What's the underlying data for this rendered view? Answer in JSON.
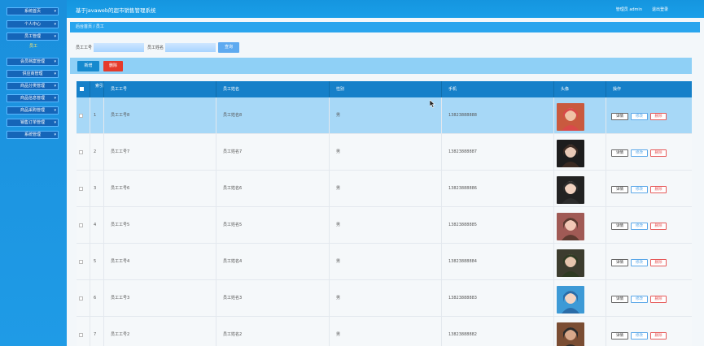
{
  "app": {
    "title": "基于javaweb的超市销售管理系统",
    "user_label": "管理员 admin",
    "logout_label": "退出登录"
  },
  "sidebar": {
    "items": [
      {
        "label": "系统首页"
      },
      {
        "label": "个人中心"
      },
      {
        "label": "员工管理"
      },
      {
        "label": "员工"
      },
      {
        "label": "会员档案管理"
      },
      {
        "label": "供应商管理"
      },
      {
        "label": "商品分类管理"
      },
      {
        "label": "商品信息管理"
      },
      {
        "label": "商品采购管理"
      },
      {
        "label": "销售订单管理"
      },
      {
        "label": "系统管理"
      }
    ]
  },
  "breadcrumb": {
    "home": "后台首页",
    "sep": "/",
    "current": "员工"
  },
  "search": {
    "field1_label": "员工工号",
    "field1_value": "",
    "field2_label": "员工姓名",
    "field2_value": "",
    "button_label": "查询"
  },
  "toolbar": {
    "add_label": "新增",
    "delete_label": "删除"
  },
  "table": {
    "headers": [
      "",
      "索引",
      "员工工号",
      "员工姓名",
      "性别",
      "手机",
      "头像",
      "操作"
    ],
    "rows": [
      {
        "index": "1",
        "id": "员工工号8",
        "name": "员工姓名8",
        "gender": "男",
        "phone": "13823888888"
      },
      {
        "index": "2",
        "id": "员工工号7",
        "name": "员工姓名7",
        "gender": "男",
        "phone": "13823888887"
      },
      {
        "index": "3",
        "id": "员工工号6",
        "name": "员工姓名6",
        "gender": "男",
        "phone": "13823888886"
      },
      {
        "index": "4",
        "id": "员工工号5",
        "name": "员工姓名5",
        "gender": "男",
        "phone": "13823888885"
      },
      {
        "index": "5",
        "id": "员工工号4",
        "name": "员工姓名4",
        "gender": "男",
        "phone": "13823888884"
      },
      {
        "index": "6",
        "id": "员工工号3",
        "name": "员工姓名3",
        "gender": "男",
        "phone": "13823888883"
      },
      {
        "index": "7",
        "id": "员工工号2",
        "name": "员工姓名2",
        "gender": "男",
        "phone": "13823888882"
      }
    ],
    "ops": {
      "detail": "详情",
      "edit": "修改",
      "delete": "删除"
    }
  },
  "colors": {
    "primary": "#1680c9",
    "danger": "#e53a2b",
    "sidebar": "#1a8fdc"
  }
}
